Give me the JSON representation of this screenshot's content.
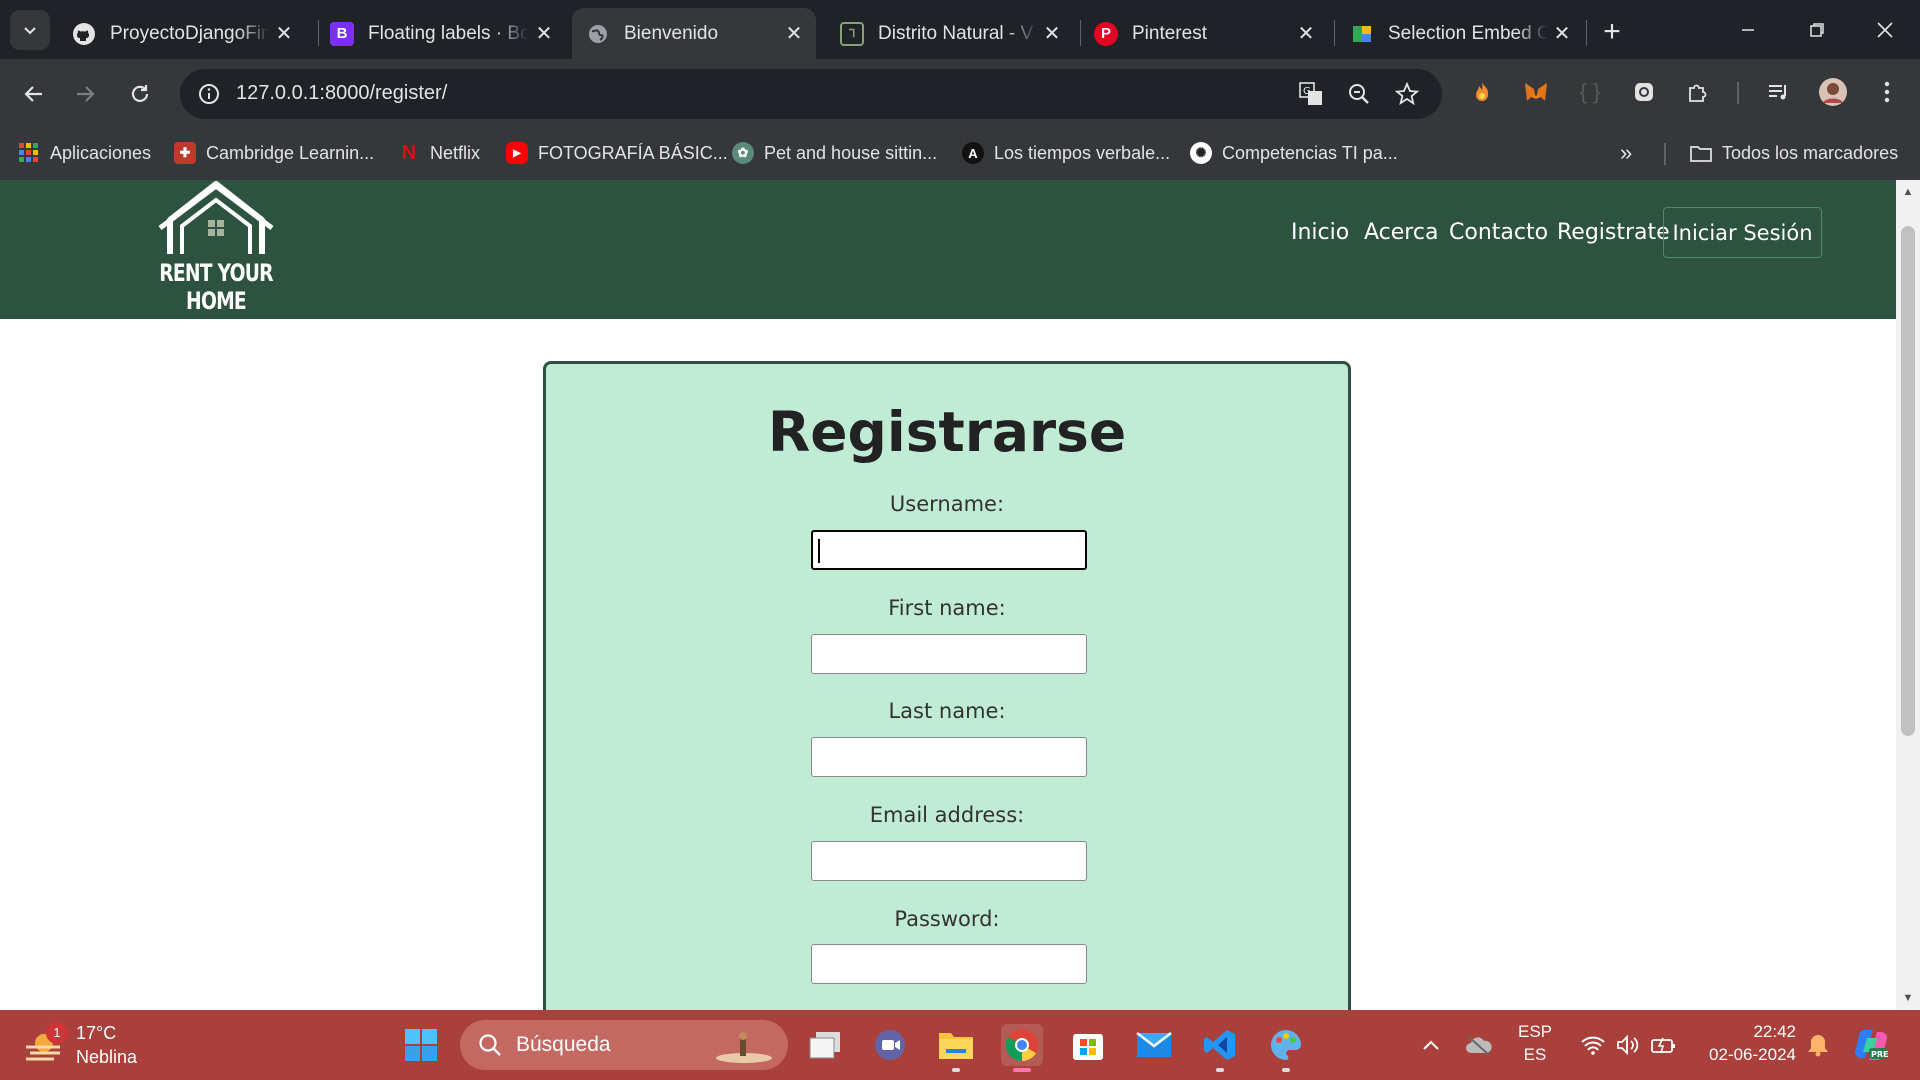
{
  "browser": {
    "tabs": [
      {
        "title": "ProyectoDjangoFinal",
        "icon": "github-icon",
        "active": false
      },
      {
        "title": "Floating labels · Bootstrap",
        "icon": "bootstrap-icon",
        "active": false
      },
      {
        "title": "Bienvenido",
        "icon": "globe-icon",
        "active": true
      },
      {
        "title": "Distrito Natural - V",
        "icon": "site-icon",
        "active": false
      },
      {
        "title": "Pinterest",
        "icon": "pinterest-icon",
        "active": false
      },
      {
        "title": "Selection Embed C",
        "icon": "figma-icon",
        "active": false
      }
    ],
    "url": "127.0.0.1:8000/register/",
    "bookmarks": [
      {
        "label": "Aplicaciones"
      },
      {
        "label": "Cambridge Learnin..."
      },
      {
        "label": "Netflix"
      },
      {
        "label": "FOTOGRAFÍA BÁSIC..."
      },
      {
        "label": "Pet and house sittin..."
      },
      {
        "label": "Los tiempos verbale..."
      },
      {
        "label": "Competencias TI pa..."
      }
    ],
    "all_bookmarks": "Todos los marcadores"
  },
  "site": {
    "logo_text": "RENT YOUR HOME",
    "nav": {
      "inicio": "Inicio",
      "acerca": "Acerca",
      "contacto": "Contacto",
      "registrate": "Registrate",
      "login": "Iniciar Sesión"
    },
    "form": {
      "title": "Registrarse",
      "fields": [
        {
          "label": "Username:",
          "value": ""
        },
        {
          "label": "First name:",
          "value": ""
        },
        {
          "label": "Last name:",
          "value": ""
        },
        {
          "label": "Email address:",
          "value": ""
        },
        {
          "label": "Password:",
          "value": ""
        }
      ]
    },
    "colors": {
      "header": "#2d5240",
      "card": "#c0ebd5"
    }
  },
  "taskbar": {
    "weather": {
      "temp": "17°C",
      "condition": "Neblina",
      "badge": "1"
    },
    "search_placeholder": "Búsqueda",
    "lang_top": "ESP",
    "lang_bottom": "ES",
    "time": "22:42",
    "date": "02-06-2024",
    "color": "#a9403b"
  }
}
